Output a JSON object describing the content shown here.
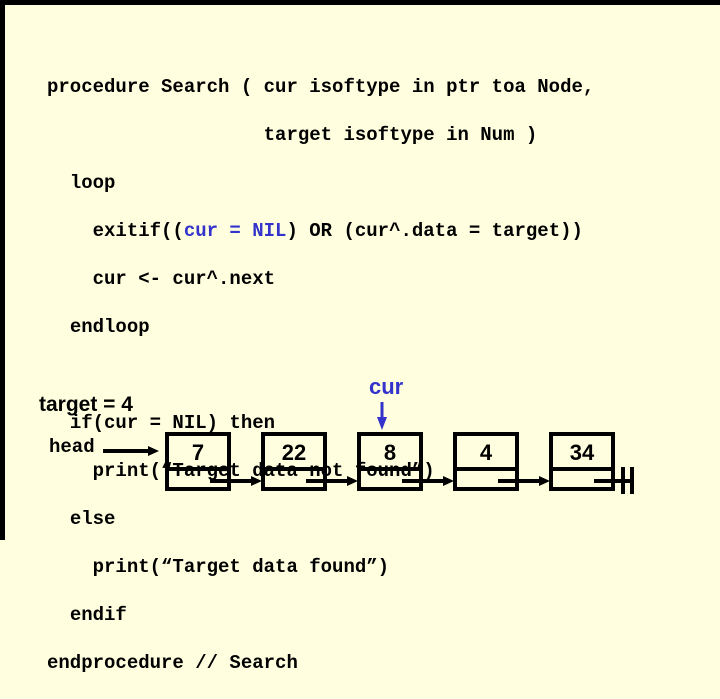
{
  "code": {
    "lines": [
      {
        "indent": 0,
        "text": "procedure Search ( cur isoftype in ptr toa Node,"
      },
      {
        "indent": 0,
        "text": "                   target isoftype in Num )"
      },
      {
        "indent": 2,
        "text": "loop"
      },
      {
        "indent": 4,
        "text_pre": "exitif((",
        "text_highlight": "cur = NIL",
        "text_post": ") OR (cur^.data = target))"
      },
      {
        "indent": 4,
        "text": "cur <- cur^.next"
      },
      {
        "indent": 2,
        "text": "endloop"
      },
      {
        "indent": 0,
        "text": ""
      },
      {
        "indent": 2,
        "text": "if(cur = NIL) then"
      },
      {
        "indent": 4,
        "text": "print(“Target data not found”)"
      },
      {
        "indent": 2,
        "text": "else"
      },
      {
        "indent": 4,
        "text": "print(“Target data found”)"
      },
      {
        "indent": 2,
        "text": "endif"
      },
      {
        "indent": 0,
        "text": "endprocedure // Search"
      }
    ],
    "highlight_color": "#3333cc"
  },
  "diagram": {
    "target_label": "target = 4",
    "head_label": "head",
    "cur_label": "cur",
    "cur_color": "#3333cc",
    "cur_points_to_index": 2,
    "nodes": [
      {
        "value": "7"
      },
      {
        "value": "22"
      },
      {
        "value": "8"
      },
      {
        "value": "4"
      },
      {
        "value": "34"
      }
    ],
    "last_next": "NIL"
  }
}
